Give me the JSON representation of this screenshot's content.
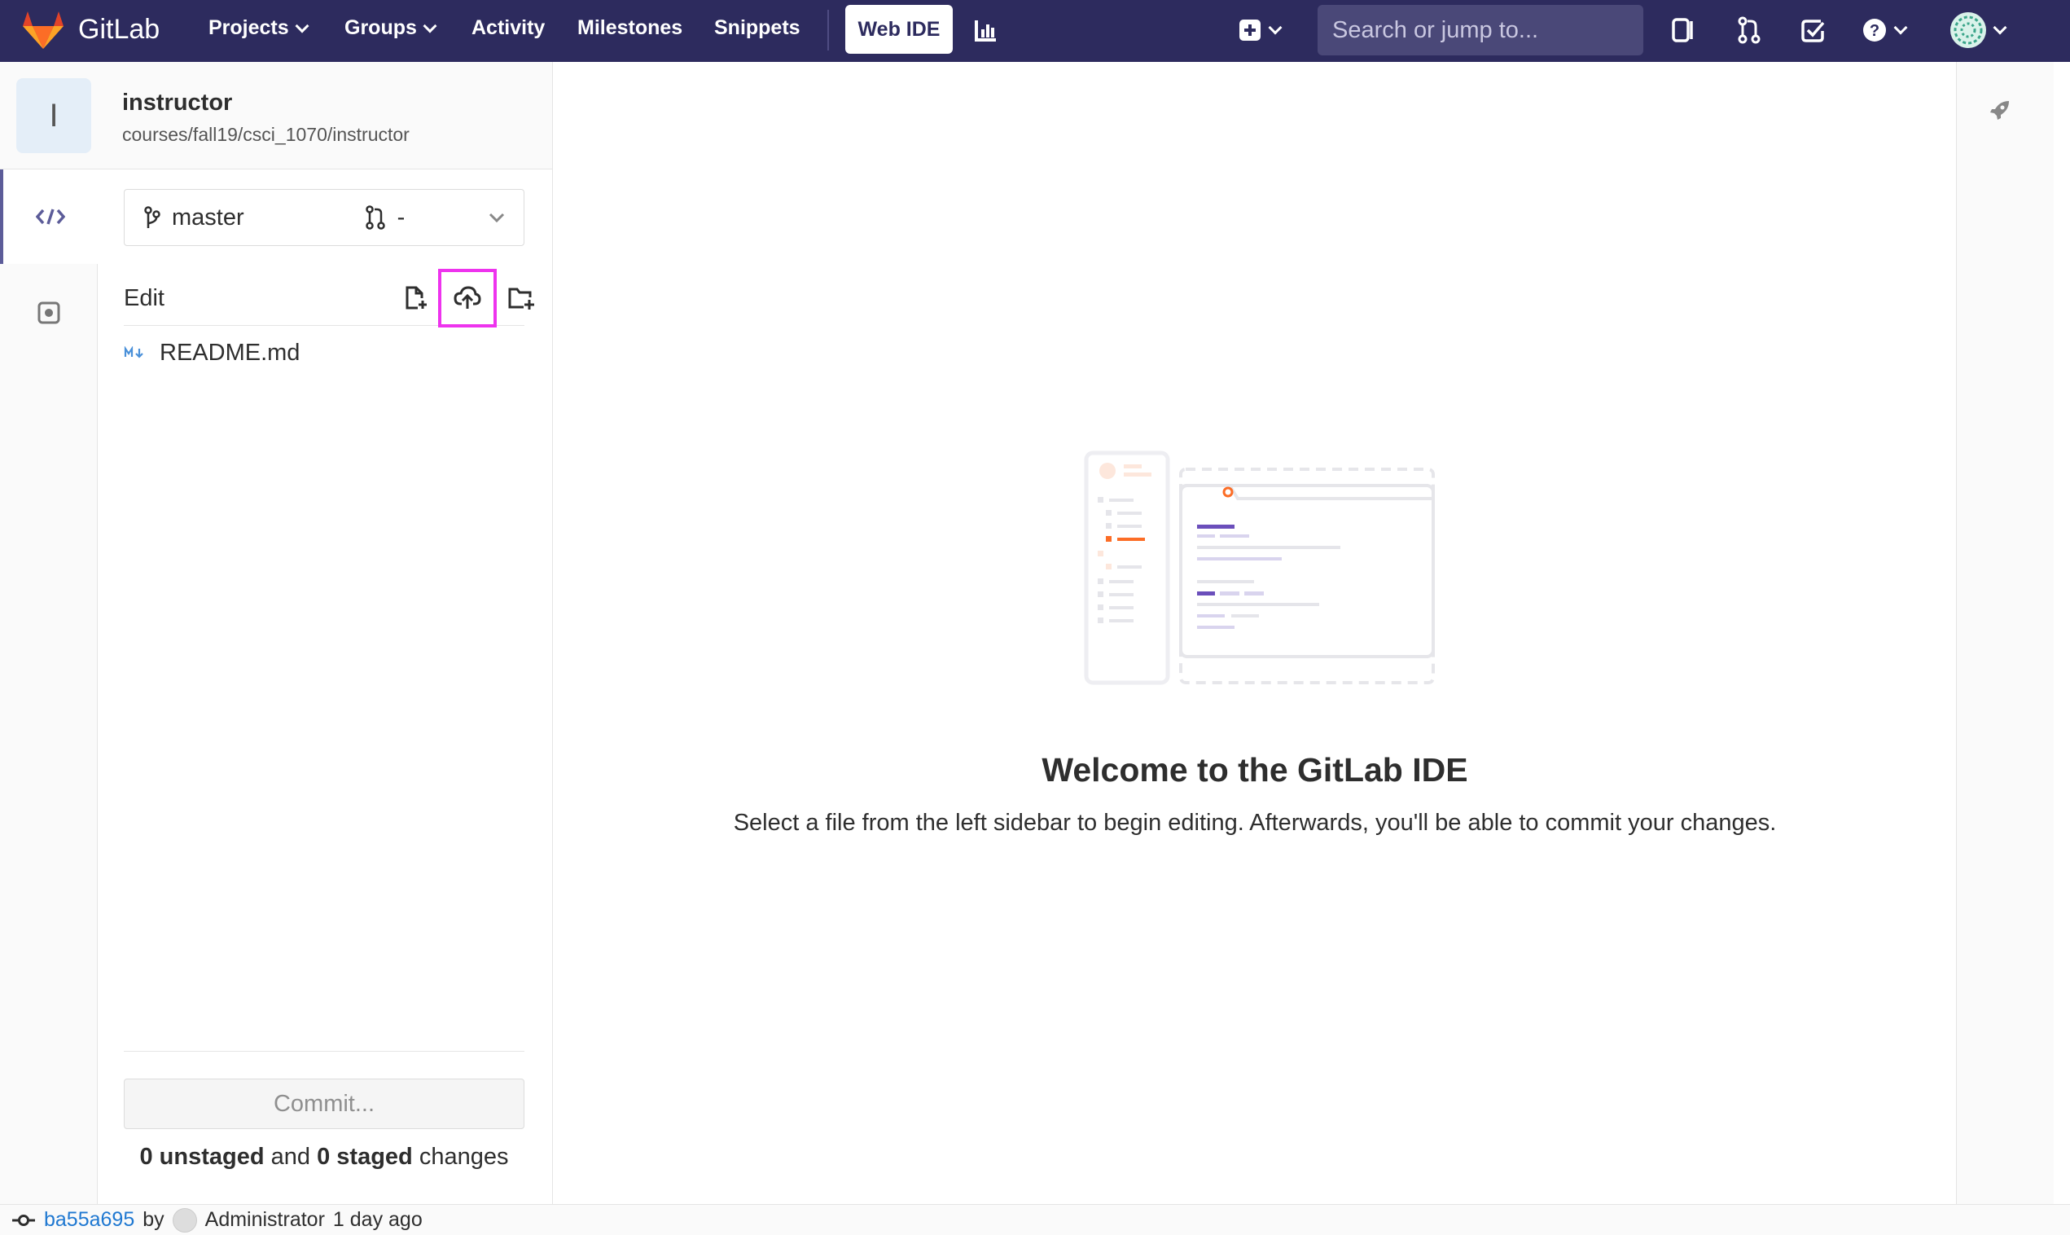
{
  "navbar": {
    "brand": "GitLab",
    "items": [
      {
        "label": "Projects"
      },
      {
        "label": "Groups"
      },
      {
        "label": "Activity"
      },
      {
        "label": "Milestones"
      },
      {
        "label": "Snippets"
      }
    ],
    "web_ide": "Web IDE",
    "search_placeholder": "Search or jump to...",
    "icons": [
      "logo-icon",
      "chart-icon",
      "plus-square-icon",
      "search-icon",
      "issues-icon",
      "merge-request-icon",
      "todo-icon",
      "help-icon",
      "user-avatar"
    ],
    "colors": {
      "background": "#2d2b5e",
      "search_bg": "#4a4878"
    }
  },
  "project": {
    "avatar_letter": "I",
    "name": "instructor",
    "path": "courses/fall19/csci_1070/instructor"
  },
  "sidebar": {
    "branch": "master",
    "merge_request": "-",
    "edit_label": "Edit",
    "files": [
      {
        "name": "README.md",
        "icon": "markdown-icon"
      }
    ],
    "commit_label": "Commit...",
    "changes": {
      "unstaged": "0 unstaged",
      "and": "and",
      "staged": "0 staged",
      "suffix": "changes"
    }
  },
  "main": {
    "title": "Welcome to the GitLab IDE",
    "subtitle": "Select a file from the left sidebar to begin editing. Afterwards, you'll be able to commit your changes."
  },
  "status": {
    "sha": "ba55a695",
    "by": "by",
    "author": "Administrator",
    "time": "1 day ago"
  },
  "highlight_color": "#ee33ee"
}
